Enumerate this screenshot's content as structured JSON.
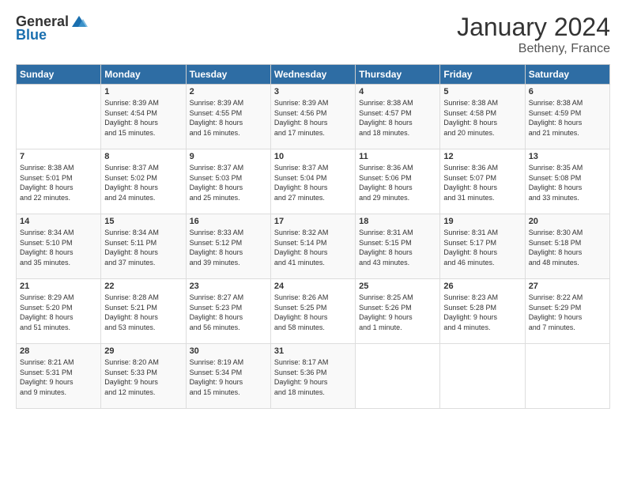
{
  "header": {
    "logo_general": "General",
    "logo_blue": "Blue",
    "month": "January 2024",
    "location": "Betheny, France"
  },
  "weekdays": [
    "Sunday",
    "Monday",
    "Tuesday",
    "Wednesday",
    "Thursday",
    "Friday",
    "Saturday"
  ],
  "weeks": [
    [
      {
        "day": "",
        "info": ""
      },
      {
        "day": "1",
        "info": "Sunrise: 8:39 AM\nSunset: 4:54 PM\nDaylight: 8 hours\nand 15 minutes."
      },
      {
        "day": "2",
        "info": "Sunrise: 8:39 AM\nSunset: 4:55 PM\nDaylight: 8 hours\nand 16 minutes."
      },
      {
        "day": "3",
        "info": "Sunrise: 8:39 AM\nSunset: 4:56 PM\nDaylight: 8 hours\nand 17 minutes."
      },
      {
        "day": "4",
        "info": "Sunrise: 8:38 AM\nSunset: 4:57 PM\nDaylight: 8 hours\nand 18 minutes."
      },
      {
        "day": "5",
        "info": "Sunrise: 8:38 AM\nSunset: 4:58 PM\nDaylight: 8 hours\nand 20 minutes."
      },
      {
        "day": "6",
        "info": "Sunrise: 8:38 AM\nSunset: 4:59 PM\nDaylight: 8 hours\nand 21 minutes."
      }
    ],
    [
      {
        "day": "7",
        "info": "Sunrise: 8:38 AM\nSunset: 5:01 PM\nDaylight: 8 hours\nand 22 minutes."
      },
      {
        "day": "8",
        "info": "Sunrise: 8:37 AM\nSunset: 5:02 PM\nDaylight: 8 hours\nand 24 minutes."
      },
      {
        "day": "9",
        "info": "Sunrise: 8:37 AM\nSunset: 5:03 PM\nDaylight: 8 hours\nand 25 minutes."
      },
      {
        "day": "10",
        "info": "Sunrise: 8:37 AM\nSunset: 5:04 PM\nDaylight: 8 hours\nand 27 minutes."
      },
      {
        "day": "11",
        "info": "Sunrise: 8:36 AM\nSunset: 5:06 PM\nDaylight: 8 hours\nand 29 minutes."
      },
      {
        "day": "12",
        "info": "Sunrise: 8:36 AM\nSunset: 5:07 PM\nDaylight: 8 hours\nand 31 minutes."
      },
      {
        "day": "13",
        "info": "Sunrise: 8:35 AM\nSunset: 5:08 PM\nDaylight: 8 hours\nand 33 minutes."
      }
    ],
    [
      {
        "day": "14",
        "info": "Sunrise: 8:34 AM\nSunset: 5:10 PM\nDaylight: 8 hours\nand 35 minutes."
      },
      {
        "day": "15",
        "info": "Sunrise: 8:34 AM\nSunset: 5:11 PM\nDaylight: 8 hours\nand 37 minutes."
      },
      {
        "day": "16",
        "info": "Sunrise: 8:33 AM\nSunset: 5:12 PM\nDaylight: 8 hours\nand 39 minutes."
      },
      {
        "day": "17",
        "info": "Sunrise: 8:32 AM\nSunset: 5:14 PM\nDaylight: 8 hours\nand 41 minutes."
      },
      {
        "day": "18",
        "info": "Sunrise: 8:31 AM\nSunset: 5:15 PM\nDaylight: 8 hours\nand 43 minutes."
      },
      {
        "day": "19",
        "info": "Sunrise: 8:31 AM\nSunset: 5:17 PM\nDaylight: 8 hours\nand 46 minutes."
      },
      {
        "day": "20",
        "info": "Sunrise: 8:30 AM\nSunset: 5:18 PM\nDaylight: 8 hours\nand 48 minutes."
      }
    ],
    [
      {
        "day": "21",
        "info": "Sunrise: 8:29 AM\nSunset: 5:20 PM\nDaylight: 8 hours\nand 51 minutes."
      },
      {
        "day": "22",
        "info": "Sunrise: 8:28 AM\nSunset: 5:21 PM\nDaylight: 8 hours\nand 53 minutes."
      },
      {
        "day": "23",
        "info": "Sunrise: 8:27 AM\nSunset: 5:23 PM\nDaylight: 8 hours\nand 56 minutes."
      },
      {
        "day": "24",
        "info": "Sunrise: 8:26 AM\nSunset: 5:25 PM\nDaylight: 8 hours\nand 58 minutes."
      },
      {
        "day": "25",
        "info": "Sunrise: 8:25 AM\nSunset: 5:26 PM\nDaylight: 9 hours\nand 1 minute."
      },
      {
        "day": "26",
        "info": "Sunrise: 8:23 AM\nSunset: 5:28 PM\nDaylight: 9 hours\nand 4 minutes."
      },
      {
        "day": "27",
        "info": "Sunrise: 8:22 AM\nSunset: 5:29 PM\nDaylight: 9 hours\nand 7 minutes."
      }
    ],
    [
      {
        "day": "28",
        "info": "Sunrise: 8:21 AM\nSunset: 5:31 PM\nDaylight: 9 hours\nand 9 minutes."
      },
      {
        "day": "29",
        "info": "Sunrise: 8:20 AM\nSunset: 5:33 PM\nDaylight: 9 hours\nand 12 minutes."
      },
      {
        "day": "30",
        "info": "Sunrise: 8:19 AM\nSunset: 5:34 PM\nDaylight: 9 hours\nand 15 minutes."
      },
      {
        "day": "31",
        "info": "Sunrise: 8:17 AM\nSunset: 5:36 PM\nDaylight: 9 hours\nand 18 minutes."
      },
      {
        "day": "",
        "info": ""
      },
      {
        "day": "",
        "info": ""
      },
      {
        "day": "",
        "info": ""
      }
    ]
  ]
}
